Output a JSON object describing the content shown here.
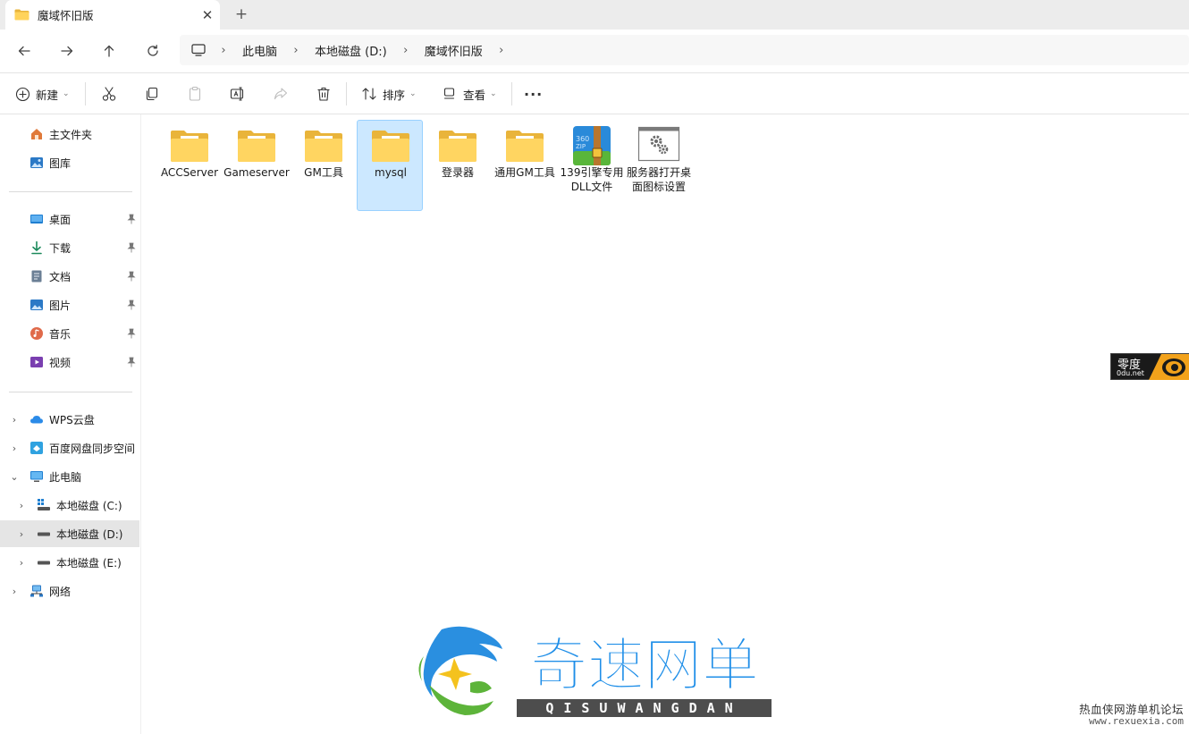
{
  "tab": {
    "title": "魔域怀旧版",
    "close": "✕",
    "new_tab": "+"
  },
  "nav": {
    "back": "←",
    "forward": "→",
    "up": "↑",
    "refresh": "↻"
  },
  "breadcrumb": [
    "此电脑",
    "本地磁盘 (D:)",
    "魔域怀旧版"
  ],
  "toolbar": {
    "new_label": "新建",
    "sort_label": "排序",
    "view_label": "查看",
    "more": "···"
  },
  "sidebar": {
    "quick": [
      {
        "label": "主文件夹",
        "icon": "home-icon"
      },
      {
        "label": "图库",
        "icon": "gallery-icon"
      }
    ],
    "pinned": [
      {
        "label": "桌面",
        "icon": "desktop-icon"
      },
      {
        "label": "下载",
        "icon": "download-icon"
      },
      {
        "label": "文档",
        "icon": "document-icon"
      },
      {
        "label": "图片",
        "icon": "pictures-icon"
      },
      {
        "label": "音乐",
        "icon": "music-icon"
      },
      {
        "label": "视频",
        "icon": "video-icon"
      }
    ],
    "tree": [
      {
        "label": "WPS云盘",
        "icon": "cloud-icon",
        "chevron": "›"
      },
      {
        "label": "百度网盘同步空间",
        "icon": "baidu-icon",
        "chevron": "›"
      },
      {
        "label": "此电脑",
        "icon": "pc-icon",
        "chevron": "⌄"
      },
      {
        "label": "本地磁盘 (C:)",
        "icon": "drive-c-icon",
        "chevron": "›"
      },
      {
        "label": "本地磁盘 (D:)",
        "icon": "drive-icon",
        "chevron": "›",
        "selected": true
      },
      {
        "label": "本地磁盘 (E:)",
        "icon": "drive-icon",
        "chevron": "›"
      },
      {
        "label": "网络",
        "icon": "network-icon",
        "chevron": "›"
      }
    ]
  },
  "files": [
    {
      "name": "ACCServer",
      "type": "folder"
    },
    {
      "name": "Gameserver",
      "type": "folder"
    },
    {
      "name": "GM工具",
      "type": "folder"
    },
    {
      "name": "mysql",
      "type": "folder",
      "selected": true
    },
    {
      "name": "登录器",
      "type": "folder"
    },
    {
      "name": "通用GM工具",
      "type": "folder"
    },
    {
      "name": "139引擎专用DLL文件",
      "type": "zip",
      "zip_label": "360 ZIP"
    },
    {
      "name": "服务器打开桌面图标设置",
      "type": "settings"
    }
  ],
  "watermarks": {
    "badge_line1": "零度",
    "badge_line2": "0du.net",
    "logo_cn": "奇速网单",
    "logo_pinyin": "QISUWANGDAN",
    "site_line1": "热血侠网游单机论坛",
    "site_line2": "www.rexuexia.com"
  },
  "colors": {
    "folder": "#f4c64f",
    "folder_light": "#ffd968",
    "selection_bg": "#cce8ff",
    "selection_border": "#99d1ff",
    "sidebar_selected": "#e5e5e5",
    "logo_blue": "#1e8ee8"
  }
}
